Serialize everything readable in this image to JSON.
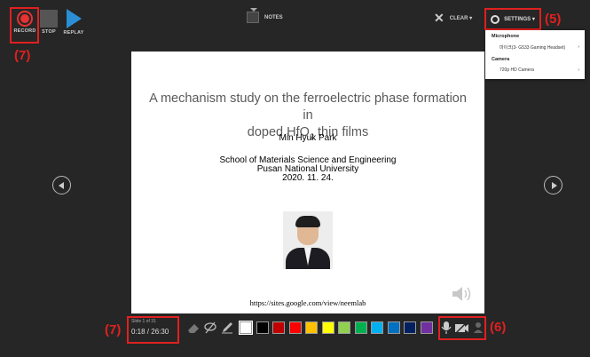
{
  "toolbar": {
    "record_label": "RECORD",
    "stop_label": "STOP",
    "replay_label": "REPLAY",
    "notes_label": "NOTES",
    "clear_label": "CLEAR",
    "settings_label": "SETTINGS"
  },
  "settings_menu": {
    "microphone_heading": "Microphone",
    "microphone_value": "마이크(3- G533 Gaming Headset)",
    "camera_heading": "Camera",
    "camera_value": "720p HD Camera"
  },
  "slide": {
    "title_line1": "A mechanism study on the ferroelectric phase formation in",
    "title_line2_pre": "doped HfO",
    "title_sub": "2",
    "title_line2_post": " thin films",
    "author": "Min Hyuk Park",
    "affiliation1": "School of Materials Science and Engineering",
    "affiliation2": "Pusan National University",
    "date": "2020. 11. 24.",
    "url": "https://sites.google.com/view/neemlab"
  },
  "status": {
    "slide_counter": "Slide 1 of 31",
    "timer": "0:18  /  26:30"
  },
  "annotations": {
    "a7_top": "(7)",
    "a5": "(5)",
    "a7_bottom": "(7)",
    "a6": "(6)"
  },
  "colors": {
    "highlight": "#e02020",
    "record": "#e63232",
    "replay": "#2b8fd6",
    "palette": [
      "#ffffff",
      "#000000",
      "#c00000",
      "#ff0000",
      "#ffc000",
      "#ffff00",
      "#92d050",
      "#00b050",
      "#00b0f0",
      "#0070c0",
      "#002060",
      "#7030a0"
    ]
  }
}
